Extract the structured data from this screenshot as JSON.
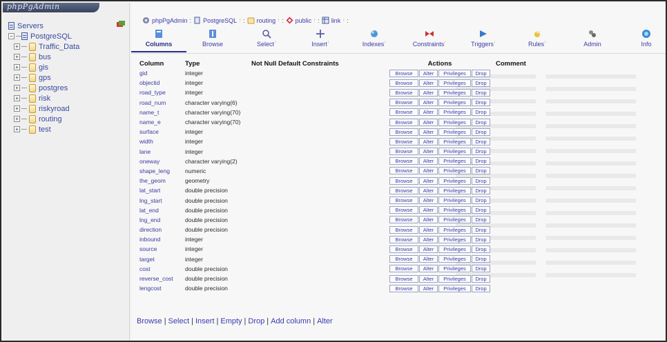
{
  "banner": {
    "logo_text": "phpPgAdmin"
  },
  "tree": {
    "root": "Servers",
    "server": "PostgreSQL",
    "databases": [
      "Traffic_Data",
      "bus",
      "gis",
      "gps",
      "postgres",
      "risk",
      "riskyroad",
      "routing",
      "test"
    ]
  },
  "breadcrumb": {
    "app": "phpPgAdmin",
    "server": "PostgreSQL",
    "database": "routing",
    "schema": "public",
    "table": "link"
  },
  "tabs": [
    {
      "label": "Columns",
      "icon": "columns-icon",
      "active": true
    },
    {
      "label": "Browse",
      "icon": "browse-icon",
      "active": false
    },
    {
      "label": "Select",
      "icon": "search-icon",
      "active": false
    },
    {
      "label": "Insert",
      "icon": "insert-icon",
      "active": false
    },
    {
      "label": "Indexes",
      "icon": "indexes-icon",
      "active": false
    },
    {
      "label": "Constraints",
      "icon": "constraints-icon",
      "active": false
    },
    {
      "label": "Triggers",
      "icon": "triggers-icon",
      "active": false
    },
    {
      "label": "Rules",
      "icon": "rules-icon",
      "active": false
    },
    {
      "label": "Admin",
      "icon": "admin-icon",
      "active": false
    },
    {
      "label": "Info",
      "icon": "info-icon",
      "active": false
    }
  ],
  "table": {
    "headers": [
      "Column",
      "Type",
      "Not Null Default Constraints",
      "Actions",
      "Comment"
    ],
    "actions": [
      "Browse",
      "Alter",
      "Privileges",
      "Drop"
    ],
    "rows": [
      {
        "column": "gid",
        "type": "integer"
      },
      {
        "column": "objectid",
        "type": "integer"
      },
      {
        "column": "road_type",
        "type": "integer"
      },
      {
        "column": "road_num",
        "type": "character varying(6)"
      },
      {
        "column": "name_t",
        "type": "character varying(70)"
      },
      {
        "column": "name_e",
        "type": "character varying(70)"
      },
      {
        "column": "surface",
        "type": "integer"
      },
      {
        "column": "width",
        "type": "integer"
      },
      {
        "column": "lane",
        "type": "integer"
      },
      {
        "column": "oneway",
        "type": "character varying(2)"
      },
      {
        "column": "shape_leng",
        "type": "numeric"
      },
      {
        "column": "the_geom",
        "type": "geometry"
      },
      {
        "column": "lat_start",
        "type": "double precision"
      },
      {
        "column": "lng_start",
        "type": "double precision"
      },
      {
        "column": "lat_end",
        "type": "double precision"
      },
      {
        "column": "lng_end",
        "type": "double precision"
      },
      {
        "column": "direction",
        "type": "double precision"
      },
      {
        "column": "inbound",
        "type": "integer"
      },
      {
        "column": "source",
        "type": "integer"
      },
      {
        "column": "target",
        "type": "integer"
      },
      {
        "column": "cost",
        "type": "double precision"
      },
      {
        "column": "reverse_cost",
        "type": "double precision"
      },
      {
        "column": "lengcost",
        "type": "double precision"
      }
    ]
  },
  "bottom_links": [
    "Browse",
    "Select",
    "Insert",
    "Empty",
    "Drop",
    "Add column",
    "Alter"
  ],
  "colors": {
    "link": "#3a3ab0",
    "db_icon": "#f1d98a",
    "border": "#2a2a2a"
  }
}
